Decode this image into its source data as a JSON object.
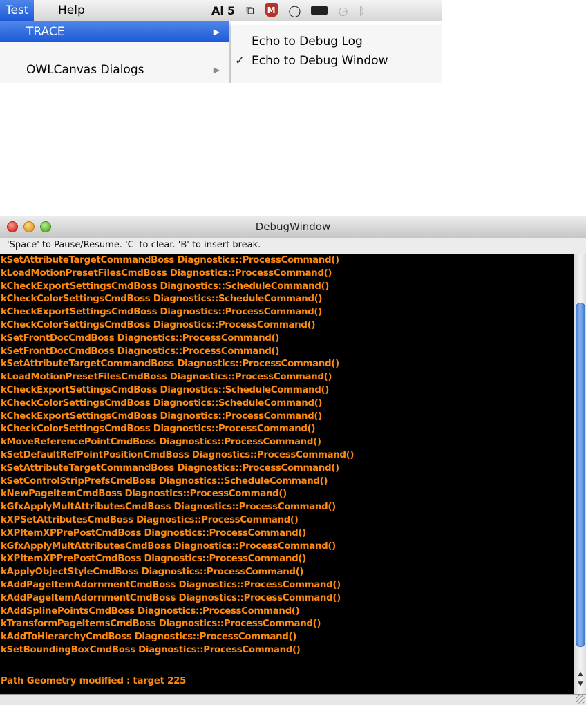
{
  "menubar": {
    "menus": [
      "Test",
      "Help"
    ],
    "adobe_label": "Ai",
    "adobe_count": "5"
  },
  "dropdown": {
    "items": [
      {
        "label": "TRACE",
        "arrow": "▶"
      },
      {
        "label": "OWLCanvas Dialogs",
        "arrow": "▶"
      }
    ]
  },
  "submenu": {
    "items": [
      {
        "label": "Echo to Debug Log",
        "check": ""
      },
      {
        "label": "Echo to Debug Window",
        "check": "✓"
      }
    ]
  },
  "window": {
    "title": "DebugWindow",
    "hint": "'Space' to Pause/Resume. 'C' to clear. 'B' to insert break."
  },
  "log": {
    "lines": [
      "kSetAttributeTargetCommandBoss Diagnostics::ProcessCommand()",
      "kLoadMotionPresetFilesCmdBoss Diagnostics::ProcessCommand()",
      "kCheckExportSettingsCmdBoss Diagnostics::ScheduleCommand()",
      "kCheckColorSettingsCmdBoss Diagnostics::ScheduleCommand()",
      "kCheckExportSettingsCmdBoss Diagnostics::ProcessCommand()",
      "kCheckColorSettingsCmdBoss Diagnostics::ProcessCommand()",
      "kSetFrontDocCmdBoss Diagnostics::ProcessCommand()",
      "kSetFrontDocCmdBoss Diagnostics::ProcessCommand()",
      "kSetAttributeTargetCommandBoss Diagnostics::ProcessCommand()",
      "kLoadMotionPresetFilesCmdBoss Diagnostics::ProcessCommand()",
      "kCheckExportSettingsCmdBoss Diagnostics::ScheduleCommand()",
      "kCheckColorSettingsCmdBoss Diagnostics::ScheduleCommand()",
      "kCheckExportSettingsCmdBoss Diagnostics::ProcessCommand()",
      "kCheckColorSettingsCmdBoss Diagnostics::ProcessCommand()",
      "kMoveReferencePointCmdBoss Diagnostics::ProcessCommand()",
      "kSetDefaultRefPointPositionCmdBoss Diagnostics::ProcessCommand()",
      "kSetAttributeTargetCommandBoss Diagnostics::ProcessCommand()",
      "kSetControlStripPrefsCmdBoss Diagnostics::ScheduleCommand()",
      "kNewPageItemCmdBoss Diagnostics::ProcessCommand()",
      "kGfxApplyMultAttributesCmdBoss Diagnostics::ProcessCommand()",
      "kXPSetAttributesCmdBoss Diagnostics::ProcessCommand()",
      "kXPItemXPPrePostCmdBoss Diagnostics::ProcessCommand()",
      "kGfxApplyMultAttributesCmdBoss Diagnostics::ProcessCommand()",
      "kXPItemXPPrePostCmdBoss Diagnostics::ProcessCommand()",
      "kApplyObjectStyleCmdBoss Diagnostics::ProcessCommand()",
      "kAddPageItemAdornmentCmdBoss Diagnostics::ProcessCommand()",
      "kAddPageItemAdornmentCmdBoss Diagnostics::ProcessCommand()",
      "kAddSplinePointsCmdBoss Diagnostics::ProcessCommand()",
      "kTransformPageItemsCmdBoss Diagnostics::ProcessCommand()",
      "kAddToHierarchyCmdBoss Diagnostics::ProcessCommand()",
      "kSetBoundingBoxCmdBoss Diagnostics::ProcessCommand()"
    ],
    "footer": "Path Geometry modified : target 225"
  },
  "colors": {
    "log_text": "#ff8a10",
    "log_background": "#000000",
    "menu_highlight": "#1c5ad8"
  }
}
